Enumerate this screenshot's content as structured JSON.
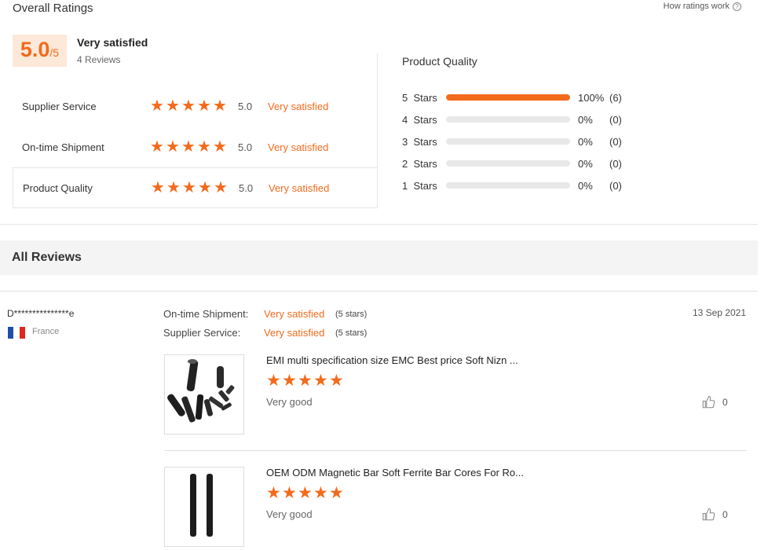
{
  "overall": {
    "title": "Overall Ratings",
    "how_link": "How ratings work",
    "help_icon": "?",
    "score": "5.0",
    "score_denominator": "/5",
    "summary_label": "Very satisfied",
    "review_count": "4 Reviews"
  },
  "categories": [
    {
      "name": "Supplier Service",
      "score": "5.0",
      "label": "Very satisfied",
      "stars": 5
    },
    {
      "name": "On-time Shipment",
      "score": "5.0",
      "label": "Very satisfied",
      "stars": 5
    },
    {
      "name": "Product Quality",
      "score": "5.0",
      "label": "Very satisfied",
      "stars": 5
    }
  ],
  "product_quality": {
    "title": "Product Quality",
    "distribution": [
      {
        "label": "5  Stars",
        "percent": "100%",
        "count": "(6)",
        "fill": 1.0
      },
      {
        "label": "4  Stars",
        "percent": "0%",
        "count": "(0)",
        "fill": 0
      },
      {
        "label": "3  Stars",
        "percent": "0%",
        "count": "(0)",
        "fill": 0
      },
      {
        "label": "2  Stars",
        "percent": "0%",
        "count": "(0)",
        "fill": 0
      },
      {
        "label": "1  Stars",
        "percent": "0%",
        "count": "(0)",
        "fill": 0
      }
    ]
  },
  "all_reviews": {
    "title": "All Reviews"
  },
  "review": {
    "reviewer": "D***************e",
    "country": "France",
    "date": "13 Sep 2021",
    "shipment_label": "On-time Shipment:",
    "shipment_value": "Very satisfied",
    "shipment_stars": "(5 stars)",
    "service_label": "Supplier Service:",
    "service_value": "Very satisfied",
    "service_stars": "(5 stars)",
    "items": [
      {
        "title": "EMI multi specification size EMC Best price Soft Nizn ...",
        "stars": 5,
        "text": "Very good",
        "likes": "0"
      },
      {
        "title": "OEM ODM Magnetic Bar Soft Ferrite Bar Cores For Ro...",
        "stars": 5,
        "text": "Very good",
        "likes": "0"
      }
    ]
  },
  "colors": {
    "accent": "#f26b1d",
    "score_bg": "#fde9d9",
    "bar_track": "#e8e8e8",
    "section_bg": "#f4f4f4"
  },
  "icons": {
    "star": "star-icon",
    "thumbs_up": "thumbs-up-icon",
    "help": "help-circle-icon",
    "flag": "france-flag-icon"
  }
}
